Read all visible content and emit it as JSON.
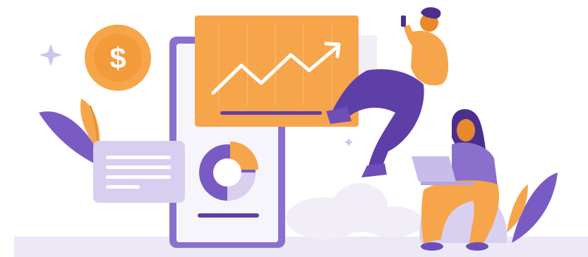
{
  "illustration": {
    "coin_symbol": "$",
    "colors": {
      "orange": "#F7A54A",
      "orange_light": "#FBC27A",
      "orange_dark": "#E88A2B",
      "purple": "#6E4FB8",
      "purple_dark": "#4A2F8F",
      "lavender": "#CFC4EC",
      "lavender_light": "#E9E4F6",
      "floor": "#E7E2F4"
    },
    "icons": [
      "dollar-coin-icon",
      "sparkle-icon",
      "trend-up-icon",
      "donut-chart-icon",
      "laptop-icon"
    ]
  },
  "donut_chart": {
    "segments": [
      {
        "label": "orange",
        "value": 0.2,
        "color": "#F7A54A"
      },
      {
        "label": "lavender",
        "value": 0.3,
        "color": "#CFC4EC"
      },
      {
        "label": "purple",
        "value": 0.5,
        "color": "#7A5BC4"
      }
    ]
  }
}
